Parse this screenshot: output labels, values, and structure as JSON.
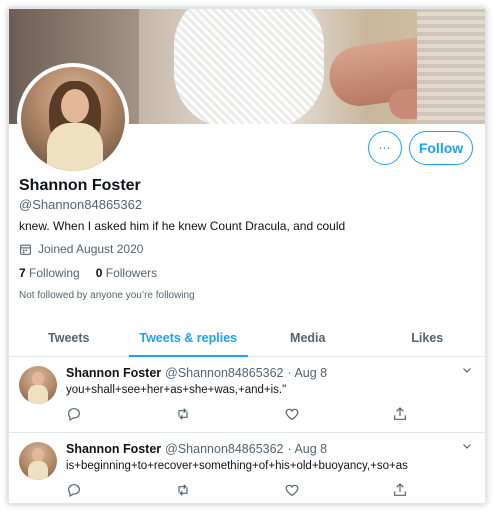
{
  "profile": {
    "name": "Shannon Foster",
    "handle": "@Shannon84865362",
    "bio": "knew. When I asked him if he knew Count Dracula, and could",
    "joined": "Joined August 2020",
    "following_count": "7",
    "following_label": "Following",
    "followers_count": "0",
    "followers_label": "Followers",
    "not_followed_text": "Not followed by anyone you’re following"
  },
  "buttons": {
    "more_label": "⋯",
    "follow_label": "Follow"
  },
  "tabs": [
    {
      "label": "Tweets",
      "active": false
    },
    {
      "label": "Tweets & replies",
      "active": true
    },
    {
      "label": "Media",
      "active": false
    },
    {
      "label": "Likes",
      "active": false
    }
  ],
  "tweets": [
    {
      "name": "Shannon Foster",
      "handle": "@Shannon84865362",
      "date": "· Aug 8",
      "text": "you+shall+see+her+as+she+was,+and+is.\""
    },
    {
      "name": "Shannon Foster",
      "handle": "@Shannon84865362",
      "date": "· Aug 8",
      "text": "is+beginning+to+recover+something+of+his+old+buoyancy,+so+as"
    }
  ],
  "icons": {
    "calendar": "calendar-icon",
    "reply": "reply-icon",
    "retweet": "retweet-icon",
    "like": "like-icon",
    "share": "share-icon",
    "chevron": "chevron-down-icon",
    "more": "more-icon"
  },
  "colors": {
    "accent": "#1da1f2",
    "secondary_text": "#536471",
    "border": "#e1e8ed"
  }
}
